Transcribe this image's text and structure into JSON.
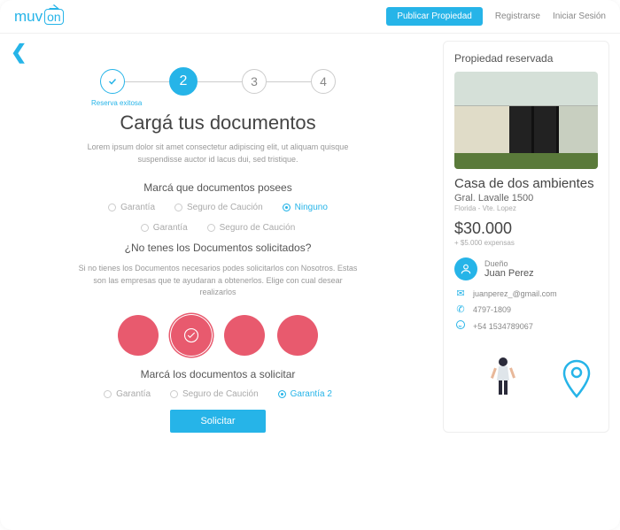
{
  "header": {
    "logo_p1": "muv",
    "logo_p2": "on",
    "publish": "Publicar Propiedad",
    "register": "Registrarse",
    "login": "Iniciar Sesión"
  },
  "steps": {
    "s1_label": "Reserva exitosa",
    "s2": "2",
    "s3": "3",
    "s4": "4"
  },
  "main": {
    "title": "Cargá tus documentos",
    "subtitle": "Lorem ipsum dolor sit amet consectetur adipiscing elit, ut aliquam quisque suspendisse auctor id lacus dui, sed tristique.",
    "docs_heading": "Marcá que documentos posees",
    "opts1": [
      "Garantía",
      "Seguro de Caución",
      "Ninguno",
      "Garantía",
      "Seguro de Caución"
    ],
    "nodocs_heading": "¿No tenes los Documentos solicitados?",
    "nodocs_text": "Si no tienes los Documentos necesarios podes solicitarlos con Nosotros. Estas son las empresas que te ayudaran a obtenerlos. Elige con cual desear realizarlos",
    "req_heading": "Marcá los documentos a solicitar",
    "opts2": [
      "Garantía",
      "Seguro de Caución",
      "Garantía 2"
    ],
    "submit": "Solicitar"
  },
  "side": {
    "heading": "Propiedad reservada",
    "title": "Casa de dos ambientes",
    "address": "Gral. Lavalle 1500",
    "location": "Florida - Vte. Lopez",
    "price": "$30.000",
    "expenses": "+ $5.000 expensas",
    "owner_label": "Dueño",
    "owner_name": "Juan Perez",
    "email": "juanperez_@gmail.com",
    "phone": "4797-1809",
    "whatsapp": "+54 1534789067"
  }
}
